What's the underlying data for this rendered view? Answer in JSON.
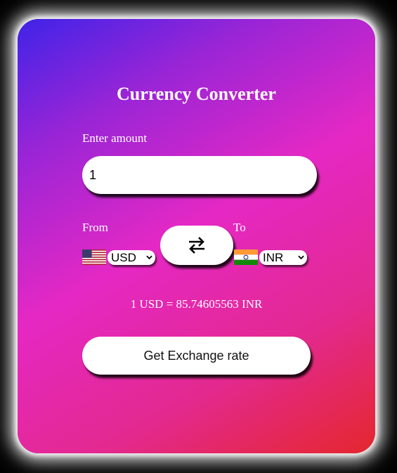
{
  "app": {
    "title": "Currency Converter"
  },
  "amount": {
    "label": "Enter amount",
    "value": "1"
  },
  "from": {
    "label": "From",
    "currency": "USD",
    "flag_icon": "us-flag-icon"
  },
  "to": {
    "label": "To",
    "currency": "INR",
    "flag_icon": "india-flag-icon"
  },
  "swap": {
    "icon": "swap-arrows-icon"
  },
  "result": {
    "text": "1 USD = 85.74605563 INR"
  },
  "button": {
    "label": "Get Exchange rate"
  },
  "colors": {
    "gradient_start": "#3f23e8",
    "gradient_mid": "#e528c4",
    "gradient_end": "#e4272d"
  }
}
